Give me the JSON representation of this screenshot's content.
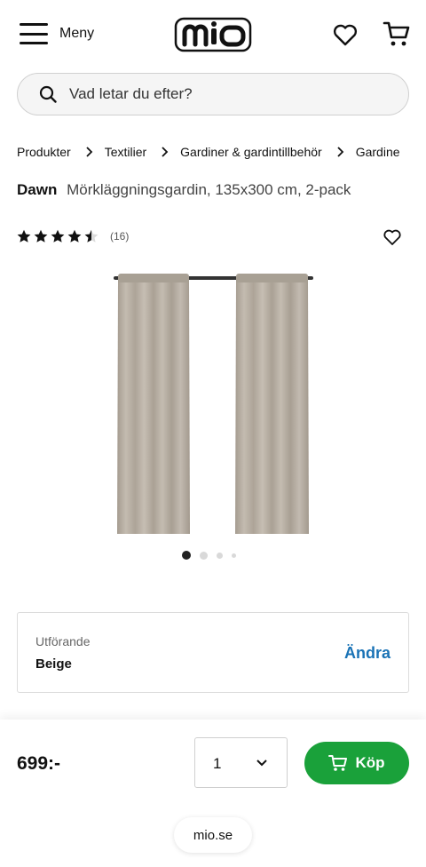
{
  "header": {
    "menu_label": "Meny",
    "logo_text": "mio"
  },
  "search": {
    "placeholder": "Vad letar du efter?"
  },
  "breadcrumb": [
    {
      "label": "Produkter"
    },
    {
      "label": "Textilier"
    },
    {
      "label": "Gardiner & gardintillbehör"
    },
    {
      "label": "Gardine"
    }
  ],
  "product": {
    "brand": "Dawn",
    "name": "Mörkläggningsgardin, 135x300 cm, 2-pack",
    "rating": 4.5,
    "rating_max": 5,
    "review_count": "(16)",
    "image_count": 4,
    "active_image": 1
  },
  "variant": {
    "label": "Utförande",
    "value": "Beige",
    "change_label": "Ändra"
  },
  "buybar": {
    "price": "699:-",
    "quantity": "1",
    "buy_label": "Köp"
  },
  "browser": {
    "url": "mio.se"
  },
  "colors": {
    "buy_green": "#1aa13a",
    "link_blue": "#1a73b6",
    "curtain_beige": "#b9b0a4"
  }
}
